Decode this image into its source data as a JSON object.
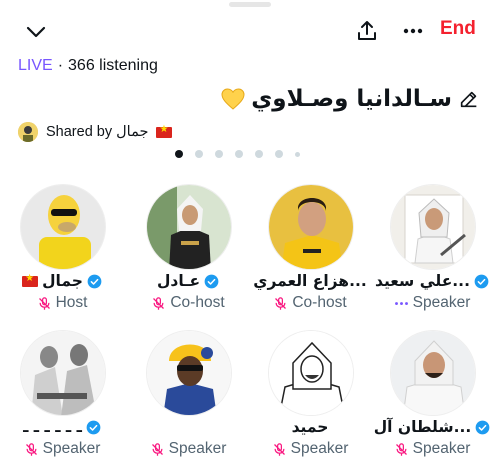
{
  "header": {
    "end_label": "End",
    "icons": [
      "chevron-down-icon",
      "share-icon",
      "more-icon"
    ]
  },
  "status": {
    "live_label": "LIVE",
    "separator": "·",
    "listening": "366 listening"
  },
  "space": {
    "title": "سـالدانيا وصـلاوي"
  },
  "shared": {
    "text": "Shared by جمال"
  },
  "pager": {
    "count": 7,
    "active_index": 0
  },
  "participants": [
    {
      "name": "جمال",
      "role": "Host",
      "verified": true,
      "flag": true
    },
    {
      "name": "عـادل",
      "role": "Co-host",
      "verified": true
    },
    {
      "name": "هزاع العمري...",
      "role": "Co-host",
      "verified": false
    },
    {
      "name": "علي سعيد...",
      "role": "Speaker",
      "verified": true,
      "speaking": true
    },
    {
      "name": "ـ ـ ـ ـ ـ ـ",
      "role": "Speaker",
      "verified": true
    },
    {
      "name": "",
      "role": "Speaker",
      "verified": false
    },
    {
      "name": "حميد",
      "role": "Speaker",
      "verified": false
    },
    {
      "name": "شلطان آل...",
      "role": "Speaker",
      "verified": true
    }
  ],
  "colors": {
    "live": "#7856ff",
    "end": "#f4212e",
    "verified": "#1d9bf0",
    "muted_mic": "#f91880",
    "heart": "#ffd24c"
  }
}
